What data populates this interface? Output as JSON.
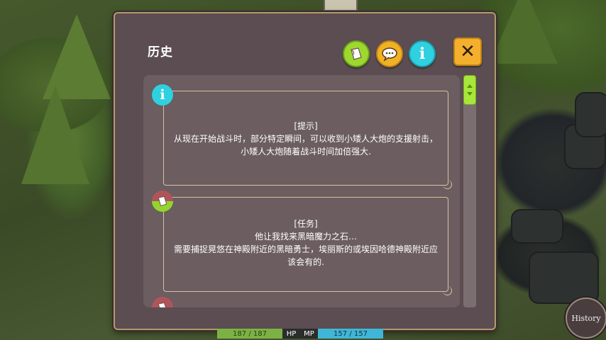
{
  "dialog": {
    "title": "历史",
    "filters": [
      {
        "name": "quest",
        "icon": "quest-scroll-icon"
      },
      {
        "name": "chat",
        "icon": "chat-bubble-icon"
      },
      {
        "name": "info",
        "icon": "info-icon",
        "glyph": "i"
      }
    ],
    "close_glyph": "✕",
    "entries": [
      {
        "type": "info",
        "icon": "info-icon",
        "glyph": "i",
        "lines": [
          "[提示]",
          "从现在开始战斗时，部分特定瞬间，可以收到小矮人大炮的支援射击，",
          "小矮人大炮随着战斗时间加倍强大."
        ]
      },
      {
        "type": "quest",
        "icon": "quest-scroll-icon",
        "lines": [
          "[任务]",
          "他让我找来黑暗魔力之石…",
          "需要捕捉晃悠在神殿附近的黑暗勇士，埃丽斯的或埃因哈德神殿附近应",
          "该会有的."
        ]
      }
    ]
  },
  "hud": {
    "hp_value": "187 / 187",
    "hp_label": "HP",
    "mp_label": "MP",
    "mp_value": "157 / 157"
  },
  "history_button": {
    "label": "History"
  },
  "colors": {
    "dialog_bg": "#5b4d51",
    "accent_green": "#9ed82f",
    "accent_yellow": "#f0b225",
    "accent_cyan": "#2fd0df"
  }
}
